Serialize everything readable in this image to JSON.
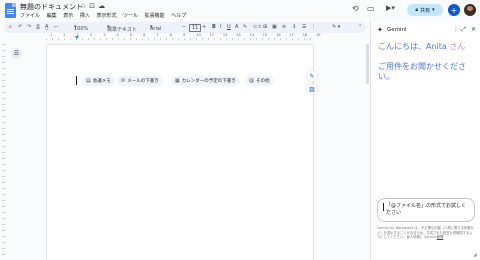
{
  "doc": {
    "title": "無題のドキュメント",
    "menus": [
      "ファイル",
      "編集",
      "表示",
      "挿入",
      "表示形式",
      "ツール",
      "拡張機能",
      "ヘルプ"
    ]
  },
  "header": {
    "share_label": "共有"
  },
  "toolbar": {
    "zoom": "100%",
    "style": "標準テキスト",
    "font": "Arial",
    "font_size": "11"
  },
  "ruler": {
    "numbers": [
      "1",
      "2",
      "1",
      "2",
      "3",
      "4",
      "5",
      "6",
      "7",
      "8",
      "9",
      "10",
      "11",
      "12",
      "13",
      "14",
      "15",
      "16",
      "17",
      "18",
      "19"
    ]
  },
  "smart_chips": [
    {
      "icon": "document-icon",
      "label": "会議メモ"
    },
    {
      "icon": "mail-icon",
      "label": "メールの下書き"
    },
    {
      "icon": "calendar-icon",
      "label": "カレンダーの予定の下書き"
    },
    {
      "icon": "at-icon",
      "label": "その他"
    }
  ],
  "gemini": {
    "title": "Gemini",
    "greeting_line1_a": "こんにちは、Anita ",
    "greeting_line1_b": "さん",
    "greeting_line2": "ご用件をお聞かせください。",
    "input_placeholder": "「@ファイル名」の形式でお試しください",
    "disclaimer": "Gemini for Workspace は、不正確な情報（人物に関する情報など）を表示することがあるため、生成された回答を再確認するようにしてください。個人情報と Gemini",
    "disclaimer_link": "新規"
  },
  "colors": {
    "accent": "#0b57d0",
    "share_bg": "#c2e7ff",
    "toolbar_bg": "#edf2fa",
    "greeting_blue": "#4d7cd6",
    "greeting_mauve": "#c987b0"
  }
}
